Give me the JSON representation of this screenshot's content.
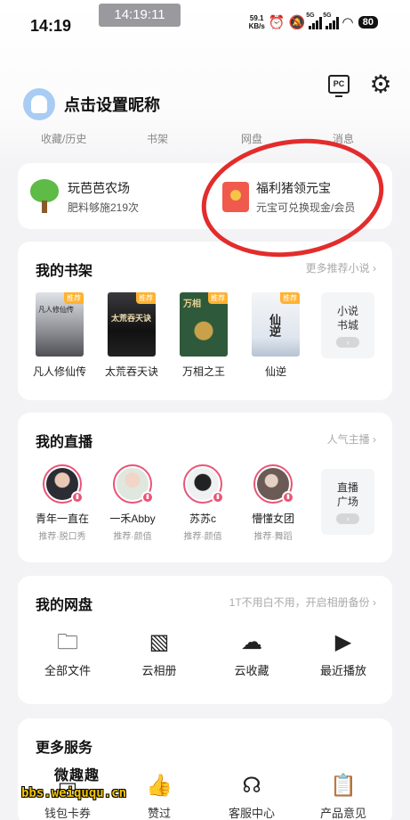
{
  "status_bar": {
    "time": "14:19",
    "overlay_time": "14:19:11",
    "net_speed_value": "59.1",
    "net_speed_unit": "KB/s",
    "signal_1_tag": "5G",
    "signal_2_tag": "5G",
    "battery": "80"
  },
  "header": {
    "nickname_prompt": "点击设置昵称",
    "pc_label": "PC",
    "settings_icon": "gear-icon"
  },
  "quick_tabs": [
    "收藏/历史",
    "书架",
    "网盘",
    "消息"
  ],
  "promo": {
    "farm_title": "玩芭芭农场",
    "farm_sub": "肥料够施219次",
    "pig_title": "福利猪领元宝",
    "pig_sub": "元宝可兑换现金/会员"
  },
  "annotation": {
    "circle_color": "#e32c2c"
  },
  "bookshelf": {
    "title": "我的书架",
    "more": "更多推荐小说",
    "recommend_badge": "推荐",
    "books": [
      {
        "title": "凡人修仙传",
        "cover_text": "凡人修仙传"
      },
      {
        "title": "太荒吞天诀",
        "cover_text": "太荒吞天诀"
      },
      {
        "title": "万相之王",
        "cover_text": "万相"
      },
      {
        "title": "仙逆",
        "cover_text": "仙逆"
      }
    ],
    "store_label_1": "小说",
    "store_label_2": "书城"
  },
  "live": {
    "title": "我的直播",
    "more": "人气主播",
    "streamers": [
      {
        "name": "青年一直在",
        "tag": "推荐·脱口秀"
      },
      {
        "name": "一禾Abby",
        "tag": "推荐·颜值"
      },
      {
        "name": "苏苏c",
        "tag": "推荐·颜值"
      },
      {
        "name": "懵懂女团",
        "tag": "推荐·舞蹈"
      }
    ],
    "square_label_1": "直播",
    "square_label_2": "广场"
  },
  "disk": {
    "title": "我的网盘",
    "more": "1T不用白不用，开启相册备份",
    "items": [
      {
        "label": "全部文件",
        "icon": "folder-icon"
      },
      {
        "label": "云相册",
        "icon": "photo-icon"
      },
      {
        "label": "云收藏",
        "icon": "cloud-upload-icon"
      },
      {
        "label": "最近播放",
        "icon": "play-icon"
      }
    ]
  },
  "services": {
    "title": "更多服务",
    "items": [
      {
        "label": "钱包卡券",
        "icon": "wallet-icon"
      },
      {
        "label": "赞过",
        "icon": "like-icon"
      },
      {
        "label": "客服中心",
        "icon": "headset-icon"
      },
      {
        "label": "产品意见",
        "icon": "feedback-icon"
      }
    ]
  },
  "watermark": {
    "cn": "微趣趣",
    "url": "bbs.weiququ.cn"
  }
}
